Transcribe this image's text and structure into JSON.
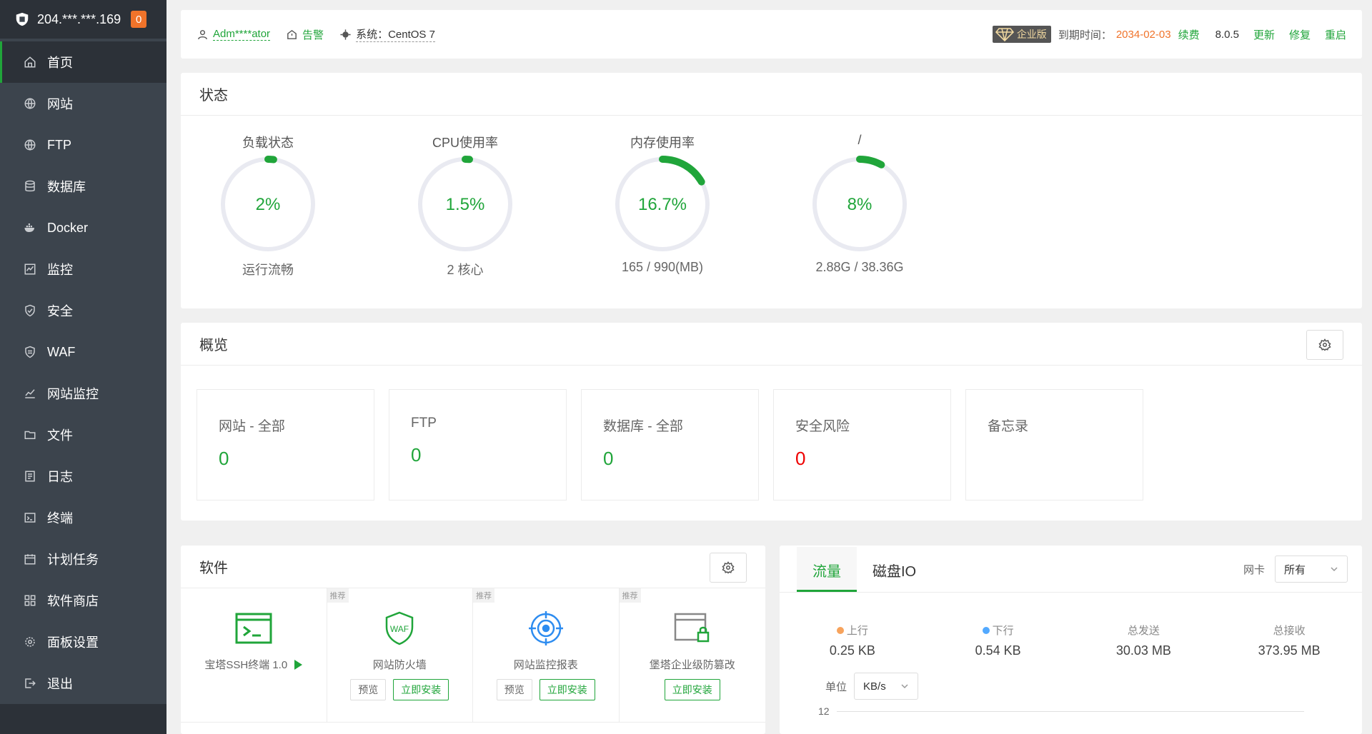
{
  "sidebar": {
    "server_ip": "204.***.***.169",
    "notice_count": "0",
    "items": [
      {
        "label": "首页",
        "icon": "home-icon"
      },
      {
        "label": "网站",
        "icon": "globe-icon"
      },
      {
        "label": "FTP",
        "icon": "globe-icon"
      },
      {
        "label": "数据库",
        "icon": "database-icon"
      },
      {
        "label": "Docker",
        "icon": "docker-icon"
      },
      {
        "label": "监控",
        "icon": "monitor-icon"
      },
      {
        "label": "安全",
        "icon": "shield-icon"
      },
      {
        "label": "WAF",
        "icon": "waf-icon"
      },
      {
        "label": "网站监控",
        "icon": "chart-icon"
      },
      {
        "label": "文件",
        "icon": "folder-icon"
      },
      {
        "label": "日志",
        "icon": "log-icon"
      },
      {
        "label": "终端",
        "icon": "terminal-icon"
      },
      {
        "label": "计划任务",
        "icon": "calendar-icon"
      },
      {
        "label": "软件商店",
        "icon": "grid-icon"
      },
      {
        "label": "面板设置",
        "icon": "gear-icon"
      },
      {
        "label": "退出",
        "icon": "logout-icon"
      }
    ]
  },
  "topbar": {
    "user": "Adm****ator",
    "alert": "告警",
    "system": "系统：CentOS 7",
    "edition": "企业版",
    "expire_label": "到期时间：",
    "expire_date": "2034-02-03",
    "renew": "续费",
    "version": "8.0.5",
    "update": "更新",
    "repair": "修复",
    "restart": "重启"
  },
  "status": {
    "title": "状态",
    "gauges": [
      {
        "title": "负载状态",
        "value": "2%",
        "percent": 2,
        "sub": "运行流畅"
      },
      {
        "title": "CPU使用率",
        "value": "1.5%",
        "percent": 1.5,
        "sub": "2 核心"
      },
      {
        "title": "内存使用率",
        "value": "16.7%",
        "percent": 16.7,
        "sub": "165 / 990(MB)"
      },
      {
        "title": "/",
        "value": "8%",
        "percent": 8,
        "sub": "2.88G / 38.36G"
      }
    ],
    "color": "#20a53a"
  },
  "overview": {
    "title": "概览",
    "cards": [
      {
        "label": "网站 - 全部",
        "value": "0",
        "alert": false
      },
      {
        "label": "FTP",
        "value": "0",
        "alert": false
      },
      {
        "label": "数据库 - 全部",
        "value": "0",
        "alert": false
      },
      {
        "label": "安全风险",
        "value": "0",
        "alert": true
      },
      {
        "label": "备忘录",
        "value": "",
        "alert": false
      }
    ]
  },
  "software": {
    "title": "软件",
    "tag": "推荐",
    "items": [
      {
        "name": "宝塔SSH终端 1.0",
        "icon": "terminal-app-icon"
      },
      {
        "name": "网站防火墙",
        "icon": "waf-app-icon",
        "preview": "预览",
        "install": "立即安装"
      },
      {
        "name": "网站监控报表",
        "icon": "monitor-report-icon",
        "preview": "预览",
        "install": "立即安装"
      },
      {
        "name": "堡塔企业级防篡改",
        "icon": "tamper-proof-icon",
        "install": "立即安装"
      }
    ]
  },
  "traffic": {
    "tabs": [
      "流量",
      "磁盘IO"
    ],
    "nic_label": "网卡",
    "nic_value": "所有",
    "stats": [
      {
        "label": "上行",
        "value": "0.25 KB",
        "dot": "#f7a35c"
      },
      {
        "label": "下行",
        "value": "0.54 KB",
        "dot": "#52a9ff"
      },
      {
        "label": "总发送",
        "value": "30.03 MB",
        "dot": ""
      },
      {
        "label": "总接收",
        "value": "373.95 MB",
        "dot": ""
      }
    ],
    "unit_label": "单位",
    "unit_value": "KB/s",
    "y_tick": "12"
  }
}
